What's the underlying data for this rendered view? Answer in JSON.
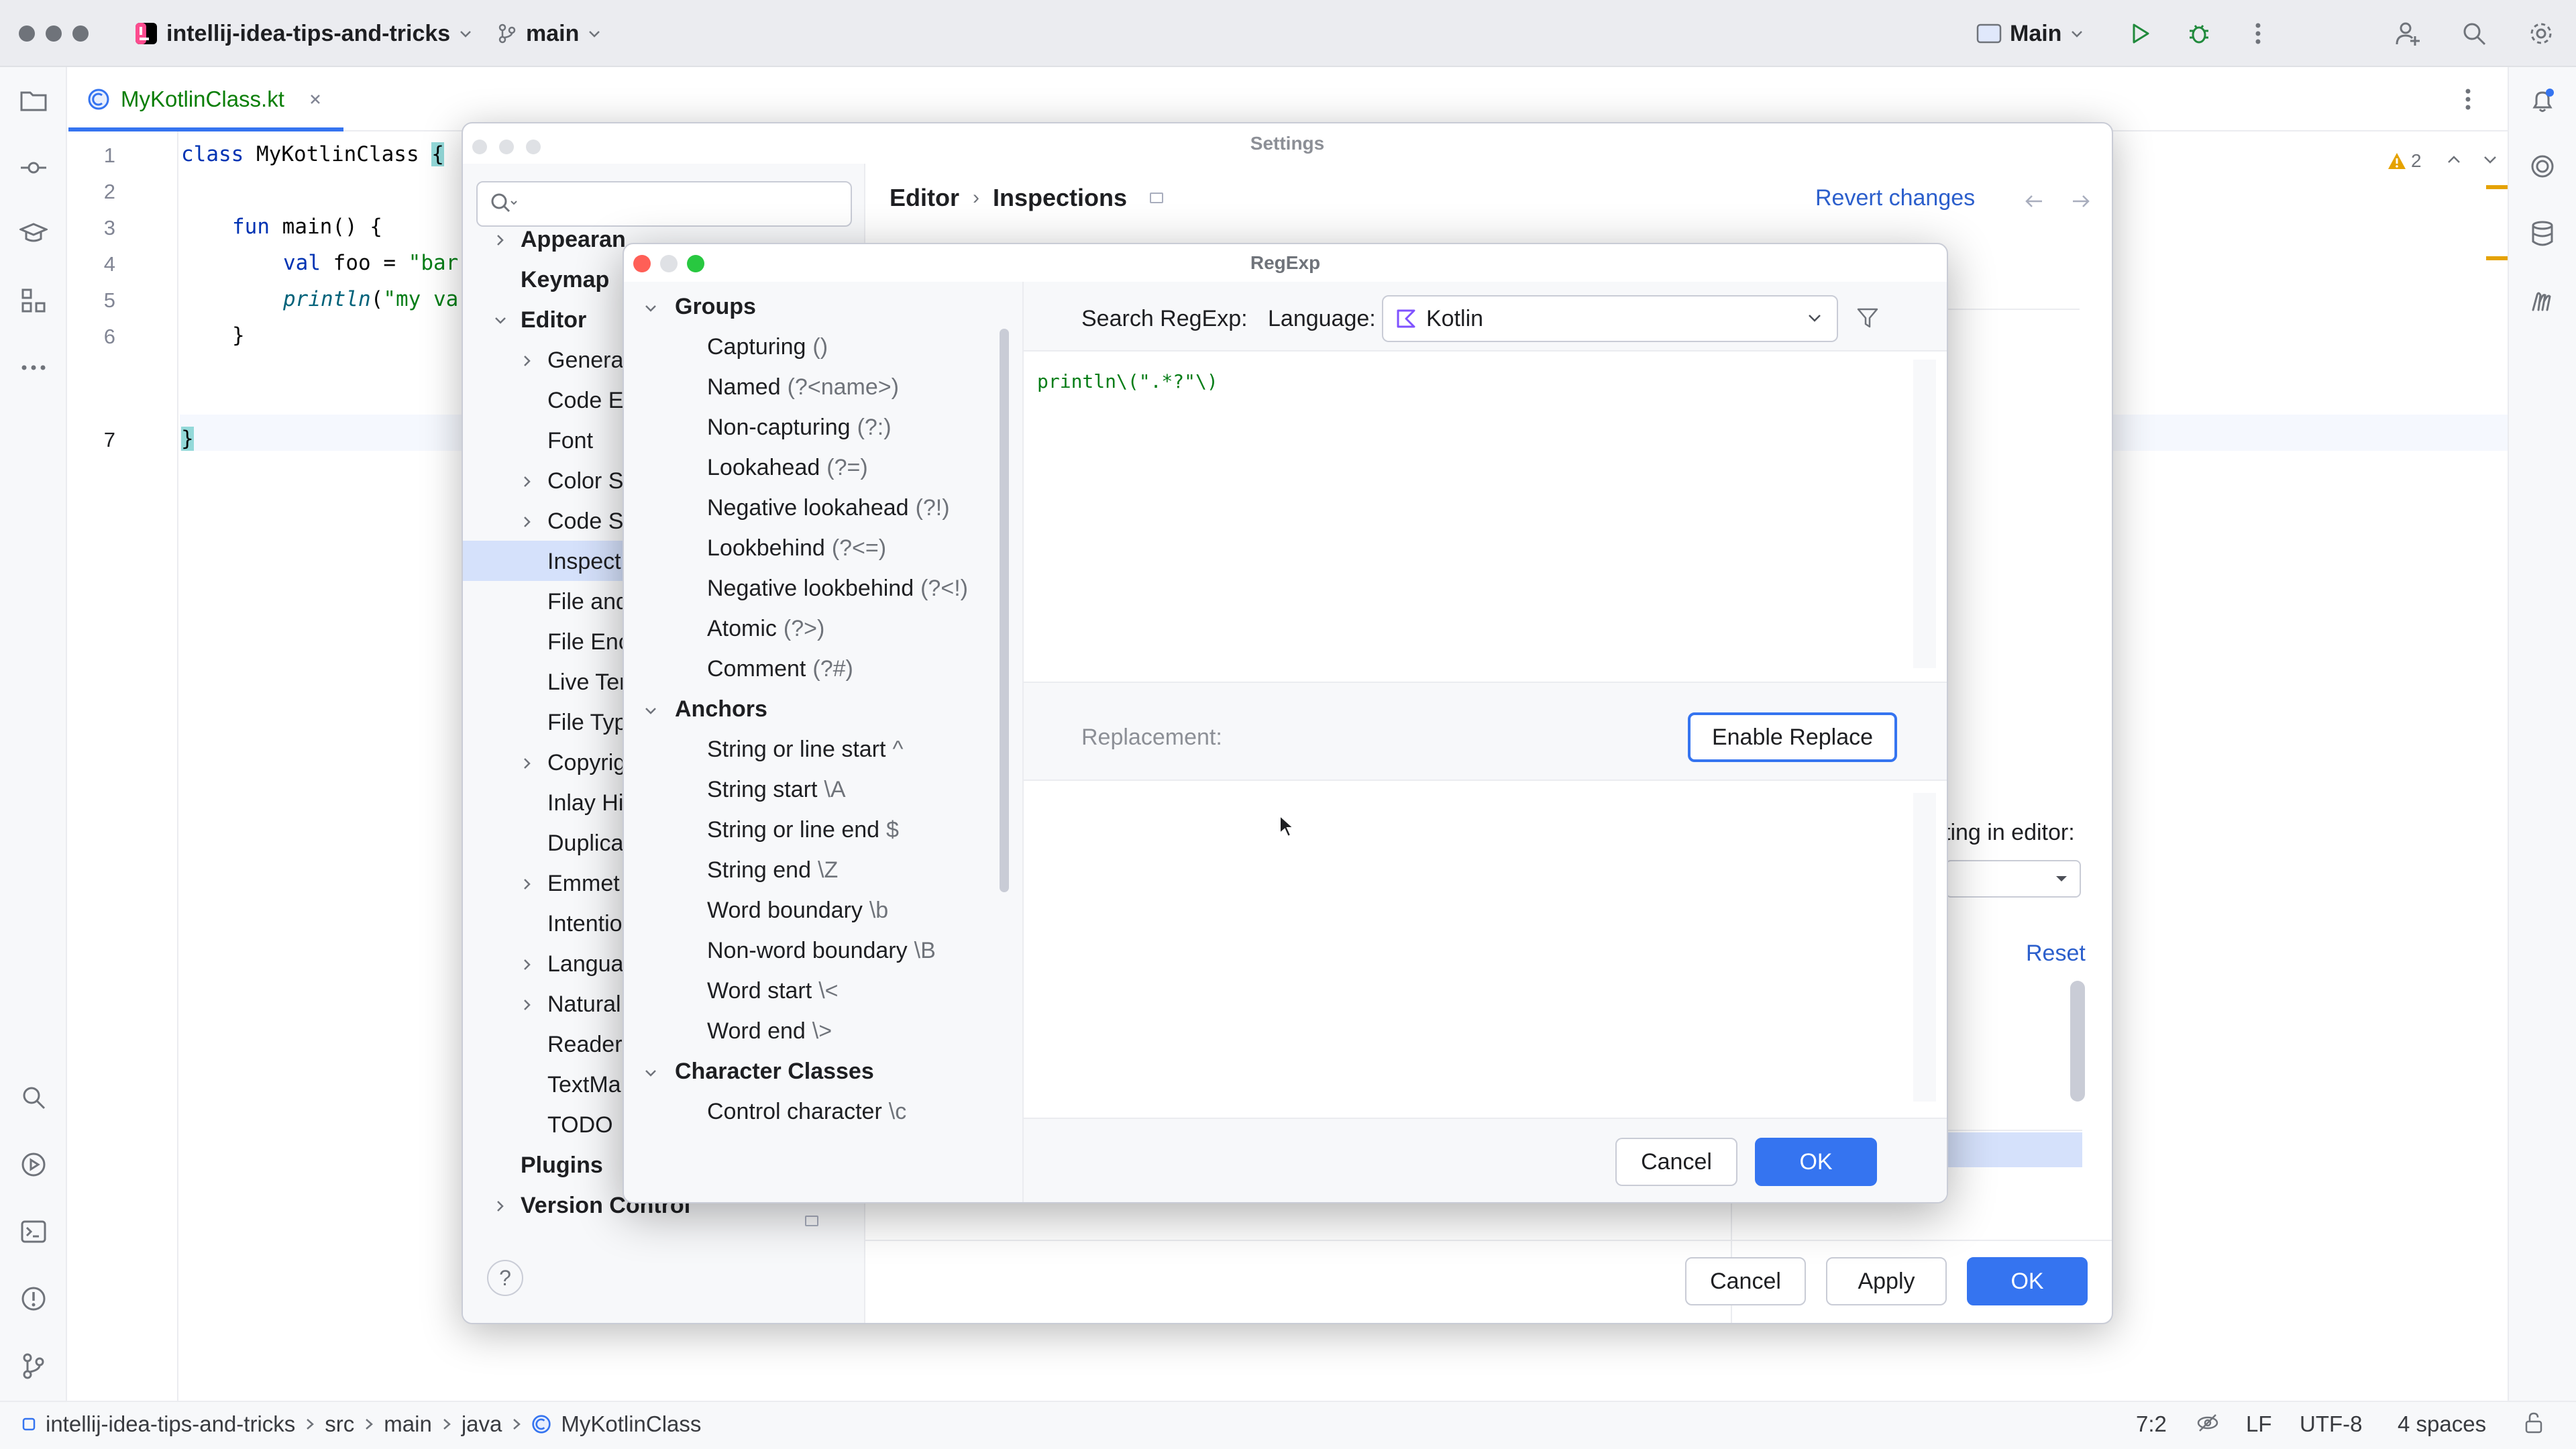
{
  "titlebar": {
    "project": "intellij-idea-tips-and-tricks",
    "branch": "main",
    "run_config": "Main"
  },
  "editor": {
    "tab_title": "MyKotlinClass.kt",
    "line_numbers": [
      "1",
      "2",
      "3",
      "4",
      "5",
      "6",
      "7"
    ],
    "code": {
      "l1_kw": "class",
      "l1_name": " MyKotlinClass ",
      "l1_brace": "{",
      "l3_kw": "fun",
      "l3_rest": " main() {",
      "l4_kw": "val",
      "l4_rest": " foo = ",
      "l4_str": "\"bar",
      "l5_fn": "println",
      "l5_rest": "(",
      "l5_str": "\"my va",
      "l6": "}",
      "l7": "}"
    },
    "warnings_count": "2"
  },
  "settings": {
    "title": "Settings",
    "breadcrumb": [
      "Editor",
      "Inspections"
    ],
    "revert_label": "Revert changes",
    "right_fragment_1": "ting in editor:",
    "right_fragment_reset": "Reset",
    "tree": [
      {
        "label": "Appearan",
        "bold": true
      },
      {
        "label": "Keymap",
        "bold": true
      },
      {
        "label": "Editor",
        "bold": true
      },
      {
        "label": "General"
      },
      {
        "label": "Code Ec"
      },
      {
        "label": "Font"
      },
      {
        "label": "Color Sc"
      },
      {
        "label": "Code St"
      },
      {
        "label": "Inspect"
      },
      {
        "label": "File and"
      },
      {
        "label": "File Enc"
      },
      {
        "label": "Live Ter"
      },
      {
        "label": "File Typ"
      },
      {
        "label": "Copyrig"
      },
      {
        "label": "Inlay Hi"
      },
      {
        "label": "Duplica"
      },
      {
        "label": "Emmet"
      },
      {
        "label": "Intentio"
      },
      {
        "label": "Langua"
      },
      {
        "label": "Natural"
      },
      {
        "label": "Reader"
      },
      {
        "label": "TextMa"
      },
      {
        "label": "TODO"
      },
      {
        "label": "Plugins",
        "bold": true
      },
      {
        "label": "Version Control",
        "bold": true
      }
    ],
    "cancel_label": "Cancel",
    "apply_label": "Apply",
    "ok_label": "OK",
    "help_label": "?"
  },
  "regexp": {
    "title": "RegExp",
    "search_label": "Search RegExp:",
    "language_label": "Language:",
    "language_value": "Kotlin",
    "pattern": "println\\(\".*?\"\\)",
    "replacement_label": "Replacement:",
    "enable_replace_label": "Enable Replace",
    "cancel_label": "Cancel",
    "ok_label": "OK",
    "groups": [
      {
        "name": "Groups",
        "items": [
          {
            "label": "Capturing",
            "syntax": "()"
          },
          {
            "label": "Named",
            "syntax": "(?<name>)"
          },
          {
            "label": "Non-capturing",
            "syntax": "(?:)"
          },
          {
            "label": "Lookahead",
            "syntax": "(?=)"
          },
          {
            "label": "Negative lookahead",
            "syntax": "(?!)"
          },
          {
            "label": "Lookbehind",
            "syntax": "(?<=)"
          },
          {
            "label": "Negative lookbehind",
            "syntax": "(?<!)"
          },
          {
            "label": "Atomic",
            "syntax": "(?>)"
          },
          {
            "label": "Comment",
            "syntax": "(?#)"
          }
        ]
      },
      {
        "name": "Anchors",
        "items": [
          {
            "label": "String or line start",
            "syntax": "^"
          },
          {
            "label": "String start",
            "syntax": "\\A"
          },
          {
            "label": "String or line end",
            "syntax": "$"
          },
          {
            "label": "String end",
            "syntax": "\\Z"
          },
          {
            "label": "Word boundary",
            "syntax": "\\b"
          },
          {
            "label": "Non-word boundary",
            "syntax": "\\B"
          },
          {
            "label": "Word start",
            "syntax": "\\<"
          },
          {
            "label": "Word end",
            "syntax": "\\>"
          }
        ]
      },
      {
        "name": "Character Classes",
        "items": [
          {
            "label": "Control character",
            "syntax": "\\c"
          }
        ]
      }
    ]
  },
  "statusbar": {
    "breadcrumb": [
      "intellij-idea-tips-and-tricks",
      "src",
      "main",
      "java",
      "MyKotlinClass"
    ],
    "position": "7:2",
    "line_ending": "LF",
    "encoding": "UTF-8",
    "indent": "4 spaces"
  },
  "colors": {
    "accent": "#3574f0",
    "selection": "#d5e1fb",
    "keyword": "#0033b3",
    "string": "#067d17",
    "kotlin_purple": "#7f52ff",
    "warning": "#e5a200"
  }
}
